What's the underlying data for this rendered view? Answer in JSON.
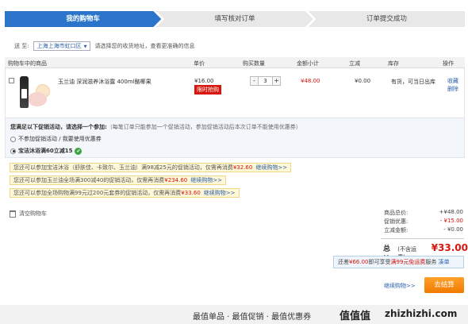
{
  "steps": [
    "我的购物车",
    "填写核对订单",
    "订单提交成功"
  ],
  "address": {
    "label": "送 至:",
    "value": "上海上海市虹口区",
    "hint": "请选择您的收货地址，查看更准确的信息"
  },
  "columns": {
    "product": "购物车中的商品",
    "price": "单价",
    "quantity": "购买数量",
    "subtotal": "金额小计",
    "discount": "立减",
    "stock": "库存",
    "action": "操作"
  },
  "item": {
    "name": "玉兰油 深润滋养沐浴露 400ml酪椰果",
    "price": "¥16.00",
    "badge": "限时抢购",
    "minus": "-",
    "qty": "3",
    "plus": "+",
    "amount": "¥48.00",
    "discount": "¥0.00",
    "stock": "有货，可当日出库",
    "op_fav": "收藏",
    "op_del": "删除"
  },
  "promo": {
    "title": "您满足以下促销活动，请选择一个参加:",
    "note": "（每笔订单只能参加一个促销活动，参加促销活动后本次订单不能使用优惠券）",
    "option1": "不参加促销活动 / 我要使用优惠券",
    "option2": "宝洁沐浴满60立减15"
  },
  "tips": [
    {
      "pre": "您还可以参加宝洁沐浴（舒肤佳、卡致尔、玉兰油）满98减25元的促销活动，仅需再消费",
      "amt": "¥32.60",
      "link": "继续购物>>"
    },
    {
      "pre": "您还可以参加玉兰油全场满300减40的促销活动，仅需再消费",
      "amt": "¥234.60",
      "link": "继续购物>>"
    },
    {
      "pre": "您还可以参加全场购物满99元过200元套券的促销活动，仅需再消费",
      "amt": "¥33.60",
      "link": "继续购物>>"
    }
  ],
  "clear_cart": "清空购物车",
  "summary": {
    "goods_label": "商品总价:",
    "goods_value": "+¥48.00",
    "promo_label": "促销优惠:",
    "promo_value": "- ¥15.00",
    "cut_label": "立减金额:",
    "cut_value": "- ¥0.00",
    "total_label": "总计",
    "total_note": "(不含运费):",
    "total_value": "¥33.00"
  },
  "freeship": {
    "pre": "还差",
    "amt": "¥66.00",
    "mid": "即可享受",
    "promo": "满99元免运费",
    "post": "服务",
    "link": "凑单"
  },
  "continue_shopping": "继续购物>>",
  "checkout": "去结算",
  "footer": {
    "slogan": "最值单品 · 最值促销 · 最值优惠券",
    "brand": "值值值",
    "domain": "zhizhizhi.com"
  }
}
